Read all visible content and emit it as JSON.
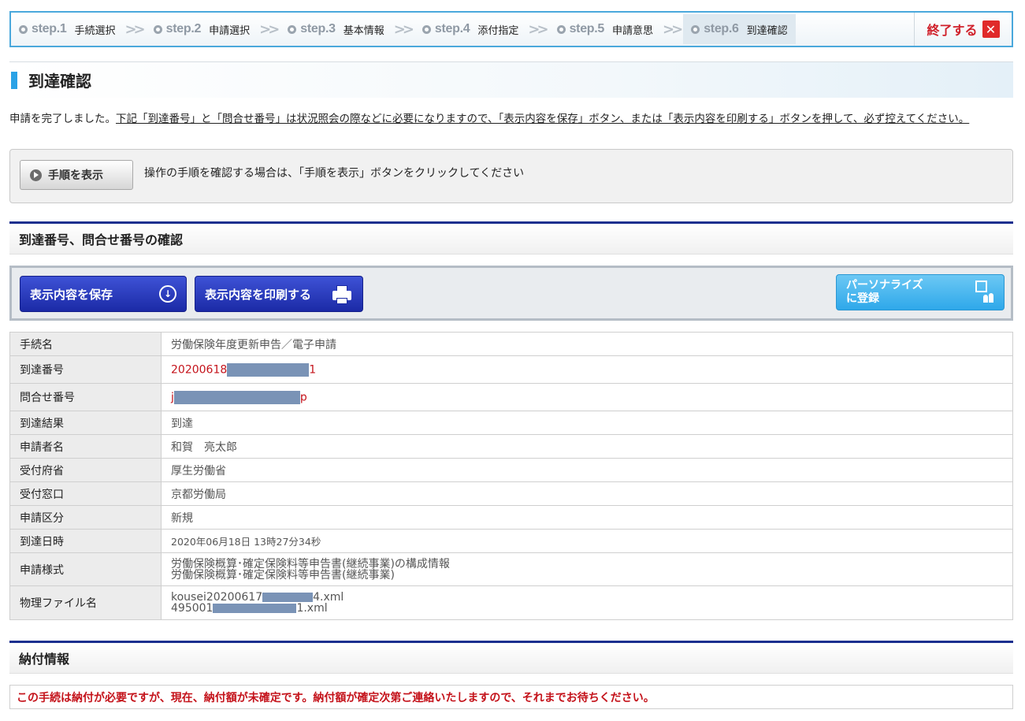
{
  "steps": [
    {
      "num": "step.1",
      "label": "手続選択"
    },
    {
      "num": "step.2",
      "label": "申請選択"
    },
    {
      "num": "step.3",
      "label": "基本情報"
    },
    {
      "num": "step.4",
      "label": "添付指定"
    },
    {
      "num": "step.5",
      "label": "申請意思"
    },
    {
      "num": "step.6",
      "label": "到達確認"
    }
  ],
  "quit_label": "終了する",
  "page_title": "到達確認",
  "notice": {
    "plain": "申請を完了しました。",
    "underlined": "下記「到達番号」と「問合せ番号」は状況照会の際などに必要になりますので、「表示内容を保存」ボタン、または「表示内容を印刷する」ボタンを押して、必ず控えてください。"
  },
  "procedure": {
    "button_label": "手順を表示",
    "text": "操作の手順を確認する場合は、「手順を表示」ボタンをクリックしてください"
  },
  "section1_title": "到達番号、問合せ番号の確認",
  "actions": {
    "save_label": "表示内容を保存",
    "print_label": "表示内容を印刷する",
    "personalize_line1": "パーソナライズ",
    "personalize_line2": "に登録"
  },
  "rows": {
    "procedure_name": {
      "key": "手続名",
      "value": "労働保険年度更新申告／電子申請"
    },
    "arrival_no": {
      "key": "到達番号",
      "prefix": "20200618",
      "suffix": "1"
    },
    "inquiry_no": {
      "key": "問合せ番号",
      "prefix": "j",
      "suffix": "p"
    },
    "result": {
      "key": "到達結果",
      "value": "到達"
    },
    "applicant": {
      "key": "申請者名",
      "value": "和賀　亮太郎"
    },
    "ministry": {
      "key": "受付府省",
      "value": "厚生労働省"
    },
    "office": {
      "key": "受付窓口",
      "value": "京都労働局"
    },
    "category": {
      "key": "申請区分",
      "value": "新規"
    },
    "datetime": {
      "key": "到達日時",
      "value": "2020年06月18日 13時27分34秒"
    },
    "format": {
      "key": "申請様式",
      "line1": "労働保険概算･確定保険料等申告書(継続事業)の構成情報",
      "line2": "労働保険概算･確定保険料等申告書(継続事業)"
    },
    "files": {
      "key": "物理ファイル名",
      "f1_prefix": "kousei20200617",
      "f1_suffix": "4.xml",
      "f2_prefix": "495001",
      "f2_suffix": "1.xml"
    }
  },
  "section2_title": "納付情報",
  "payment_notice": "この手続は納付が必要ですが、現在、納付額が未確定です。納付額が確定次第ご連絡いたしますので、それまでお待ちください。"
}
